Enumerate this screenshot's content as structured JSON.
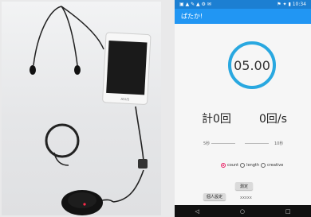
{
  "phone": {
    "statusbar": {
      "left_icons": "▣ ▲ ✎ ▲ ⚙ ✉",
      "right_icons": "⚑ ✦ ▮ 10:34"
    },
    "app_title": "ぱたか!",
    "timer_display": "05.00",
    "count_total": "計0回",
    "count_rate": "0回/s",
    "slider": {
      "min_label": "5秒",
      "mid_label": "",
      "max_label": "10秒"
    },
    "mode_options": [
      {
        "label": "count",
        "selected": true
      },
      {
        "label": "length",
        "selected": false
      },
      {
        "label": "creative",
        "selected": false
      }
    ],
    "measure_button": "測定",
    "history_button": "個人設定",
    "history_value": "xxxxx",
    "nav_icons": [
      "back-icon",
      "home-icon",
      "recents-icon"
    ]
  },
  "photo": {
    "device_brand": "ASUS"
  }
}
